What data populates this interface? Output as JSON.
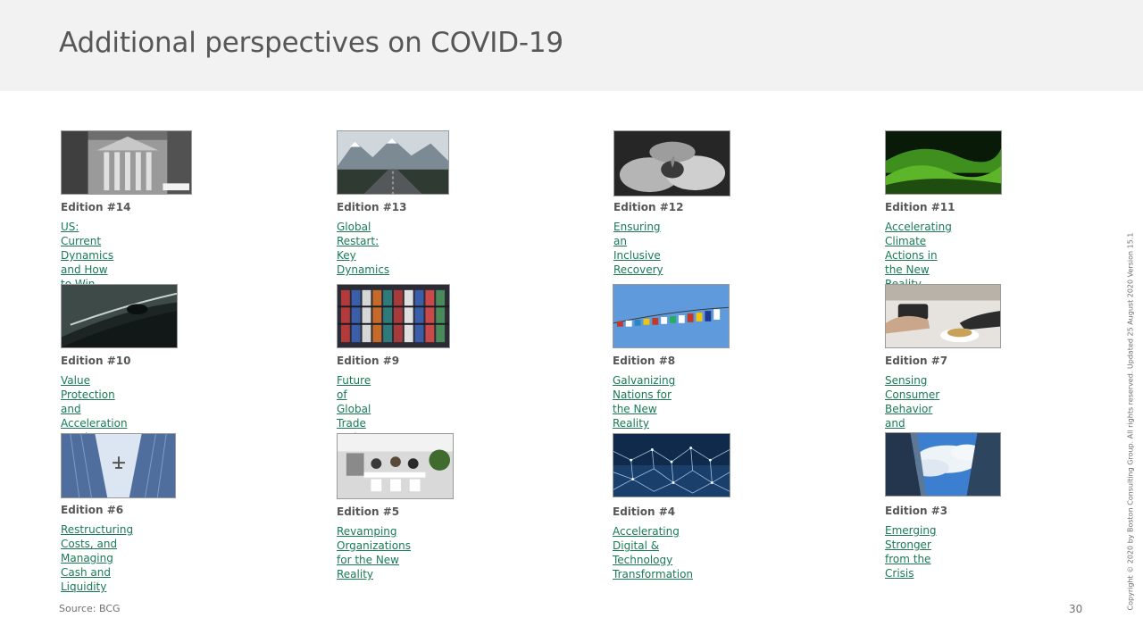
{
  "header": {
    "title": "Additional perspectives on COVID-19"
  },
  "editions": [
    {
      "edition": "Edition #14",
      "title": "US: Current Dynamics\nand How to Win the Fight",
      "image": "new-york-stock-exchange-photo"
    },
    {
      "edition": "Edition #13",
      "title": "Global Restart:\nKey Dynamics",
      "image": "mountain-road-photo"
    },
    {
      "edition": "Edition #12",
      "title": "Ensuring an Inclusive\nRecovery",
      "image": "cupped-hands-soil-photo"
    },
    {
      "edition": "Edition #11",
      "title": "Accelerating Climate\nActions in the New Reality",
      "image": "green-hills-photo"
    },
    {
      "edition": "Edition #10",
      "title": "Value Protection and\nAcceleration Roadmap to\nWin in the New Reality",
      "image": "tunnel-photo"
    },
    {
      "edition": "Edition #9",
      "title": "Future of Global Trade\nand Supply Chains",
      "image": "shipping-containers-photo"
    },
    {
      "edition": "Edition #8",
      "title": "Galvanizing Nations for\nthe New Reality",
      "image": "flags-bunting-photo"
    },
    {
      "edition": "Edition #7",
      "title": "Sensing Consumer Behavior\nand Seizing Demand Shifts",
      "image": "card-payment-photo"
    },
    {
      "edition": "Edition #6",
      "title": "Restructuring Costs, and\nManaging Cash and Liquidity",
      "image": "airplane-between-buildings-photo"
    },
    {
      "edition": "Edition #5",
      "title": "Revamping Organizations\nfor the New Reality",
      "image": "office-meeting-photo"
    },
    {
      "edition": "Edition #4",
      "title": "Accelerating Digital &\nTechnology Transformation",
      "image": "digital-network-photo"
    },
    {
      "edition": "Edition #3",
      "title": "Emerging Stronger\nfrom the Crisis",
      "image": "skyscrapers-sky-photo"
    }
  ],
  "footer": {
    "source": "Source: BCG",
    "page_number": "30",
    "copyright": "Copyright © 2020 by Boston Consulting Group. All rights reserved. Updated 25 August 2020 Version 15.1"
  },
  "colors": {
    "link": "#197a56",
    "header_band": "#f2f2f2",
    "heading_text": "#575757"
  }
}
